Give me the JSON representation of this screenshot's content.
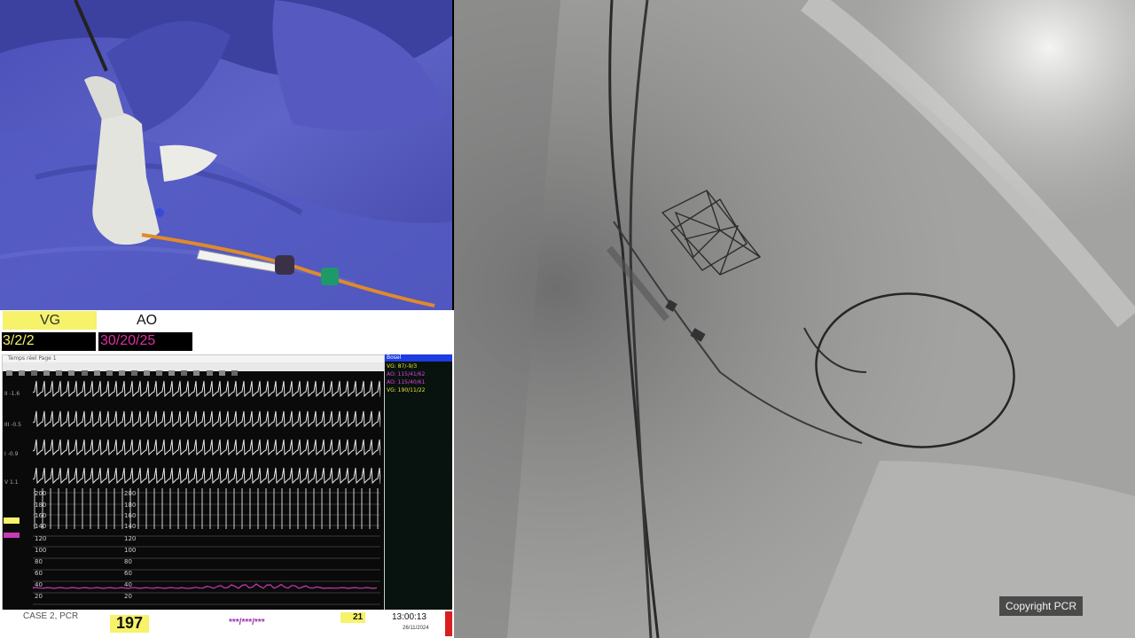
{
  "monitor": {
    "channel_left_label": "VG",
    "channel_right_label": "AO",
    "vg_pressure": "3/2/2",
    "ao_pressure": "30/20/25",
    "window_title": "Temps réel Page 1",
    "ecg_leads": [
      "II -1.6",
      "III -0.5",
      "I -0.9",
      "V 1.1"
    ],
    "y_ticks_top": [
      "200",
      "180",
      "160",
      "140"
    ],
    "y_ticks_bottom": [
      "120",
      "100",
      "80",
      "60",
      "40",
      "20"
    ],
    "side_panel": {
      "header": "Bosel",
      "lines": [
        {
          "text": "VG: 87/-9/3",
          "color": "#e8e830"
        },
        {
          "text": "AO: 115/41/62",
          "color": "#e040e0"
        },
        {
          "text": "AO: 115/40/61",
          "color": "#e040e0"
        },
        {
          "text": "VG: 190/11/22",
          "color": "#e8e830"
        }
      ]
    },
    "footer": {
      "case": "CASE 2, PCR",
      "heart_rate": "197",
      "pressure_dashes": "***/***/***",
      "temp_value": "21",
      "time": "13:00:13",
      "date": "26/11/2024"
    }
  },
  "xray": {
    "copyright": "Copyright PCR"
  },
  "colors": {
    "drape": "#5a5fc0",
    "vg_highlight": "#f6f26a",
    "ao_text": "#e02fa4",
    "ecg_trace": "#e8ece8",
    "pressure_trace": "#c83ab8"
  }
}
